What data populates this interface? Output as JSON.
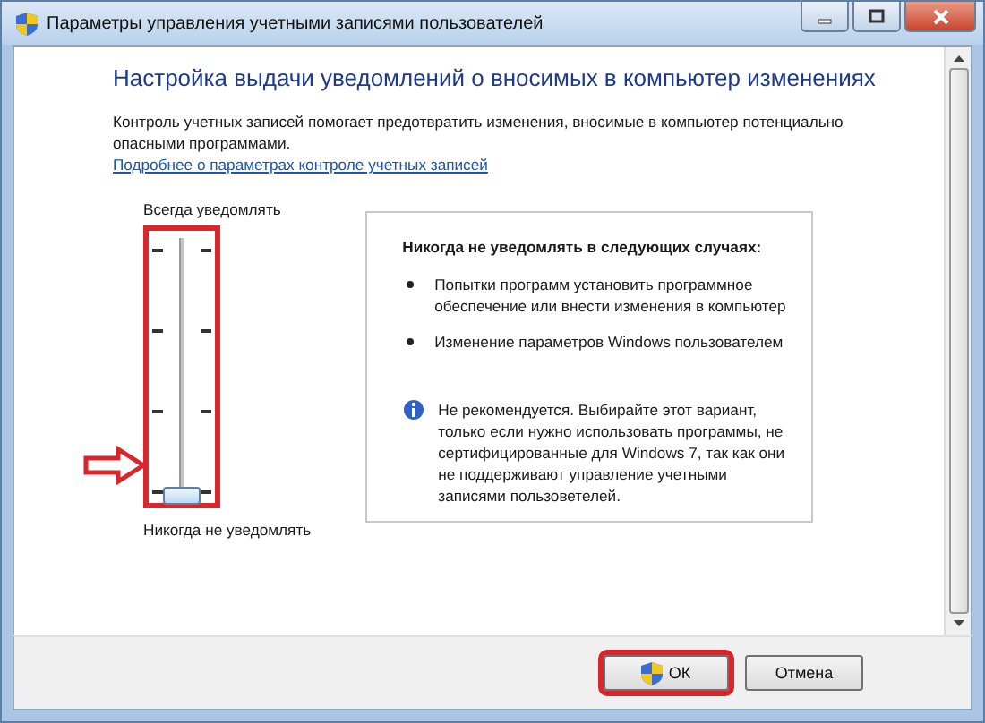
{
  "window": {
    "title": "Параметры управления учетными записями пользователей"
  },
  "heading": "Настройка выдачи уведомлений о вносимых в компьютер изменениях",
  "description": "Контроль учетных записей помогает предотвратить изменения, вносимые в компьютер потенциально опасными программами.",
  "link": "Подробнее о параметрах контроле учетных записей",
  "slider": {
    "top_label": "Всегда уведомлять",
    "bottom_label": "Никогда не уведомлять",
    "level": 0,
    "highlighted": true
  },
  "info_panel": {
    "title": "Никогда не уведомлять в следующих случаях:",
    "bullets": [
      "Попытки программ установить программное обеспечение или внести изменения в компьютер",
      "Изменение параметров Windows пользователем"
    ],
    "note": "Не рекомендуется. Выбирайте этот вариант, только если нужно использовать программы, не сертифицированные для Windows 7, так как они не поддерживают управление учетными записями пользоветелей."
  },
  "buttons": [
    {
      "label": "ОК",
      "kind": "shield",
      "highlighted": true
    },
    {
      "label": "Отмена",
      "kind": "plain",
      "highlighted": false
    }
  ]
}
